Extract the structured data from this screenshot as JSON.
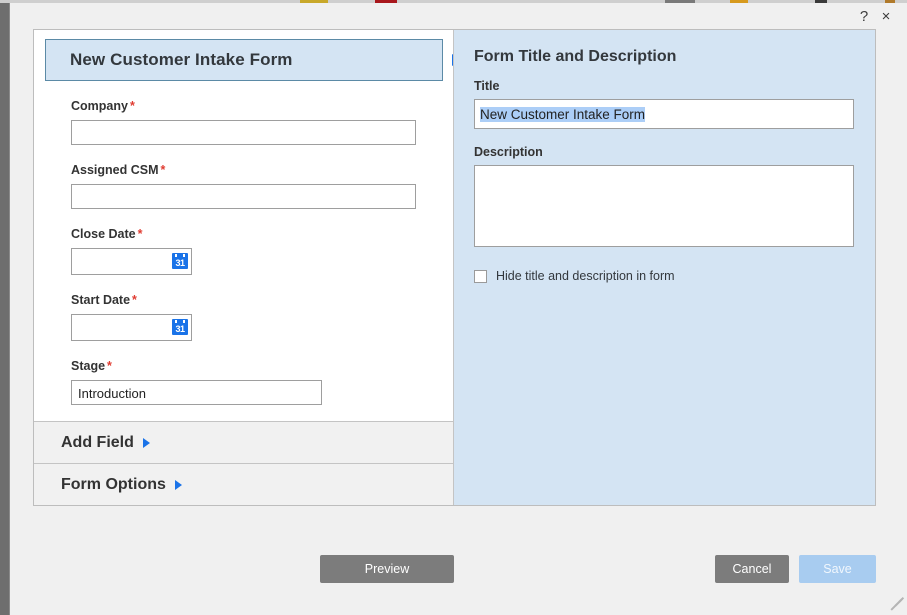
{
  "window": {
    "help_icon": "question-mark-icon",
    "help_label": "?",
    "close_icon": "close-icon",
    "close_label": "×"
  },
  "form_builder": {
    "selected_block_title": "New Customer Intake Form",
    "fields": [
      {
        "label": "Company",
        "required": "*",
        "type": "text",
        "value": "",
        "placeholder": ""
      },
      {
        "label": "Assigned CSM",
        "required": "*",
        "type": "text",
        "value": "",
        "placeholder": ""
      },
      {
        "label": "Close Date",
        "required": "*",
        "type": "date",
        "value": "",
        "placeholder": "",
        "icon": "calendar-icon",
        "icon_text": "31"
      },
      {
        "label": "Start Date",
        "required": "*",
        "type": "date",
        "value": "",
        "placeholder": "",
        "icon": "calendar-icon",
        "icon_text": "31"
      },
      {
        "label": "Stage",
        "required": "*",
        "type": "select",
        "value": "Introduction",
        "placeholder": ""
      }
    ],
    "accordions": [
      {
        "label": "Add Field",
        "icon": "triangle-right-icon"
      },
      {
        "label": "Form Options",
        "icon": "triangle-right-icon"
      }
    ]
  },
  "properties_panel": {
    "heading": "Form Title and Description",
    "title_label": "Title",
    "title_value": "New Customer Intake Form",
    "title_placeholder": "",
    "description_label": "Description",
    "description_value": "",
    "description_placeholder": "",
    "hide_checkbox_label": "Hide title and description in form",
    "hide_checkbox_checked": false
  },
  "footer": {
    "preview_label": "Preview",
    "cancel_label": "Cancel",
    "save_label": "Save",
    "save_disabled": true
  },
  "colors": {
    "accent_blue": "#1a73e8",
    "panel_blue": "#d4e4f3",
    "selected_border": "#5b8aa6",
    "button_gray": "#7c7c7c",
    "save_disabled": "#a8ccf0",
    "required_red": "#e03c31",
    "window_bg": "#f0f0f0"
  }
}
